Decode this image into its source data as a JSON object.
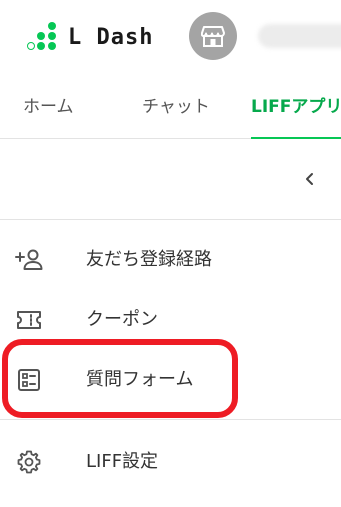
{
  "header": {
    "logo_text": "L Dash",
    "logo_icon": "ldash-dots-logo",
    "shop_avatar_icon": "store-icon",
    "brand_color": "#06c755"
  },
  "tabs": [
    {
      "label": "ホーム",
      "active": false
    },
    {
      "label": "チャット",
      "active": false
    },
    {
      "label": "LIFFアプリ",
      "active": true
    }
  ],
  "collapse_icon": "chevron-left-icon",
  "menu": {
    "items": [
      {
        "label": "友だち登録経路",
        "icon": "person-add-icon"
      },
      {
        "label": "クーポン",
        "icon": "ticket-icon"
      },
      {
        "label": "質問フォーム",
        "icon": "form-icon",
        "highlighted": true
      },
      {
        "label": "LIFF設定",
        "icon": "gear-icon"
      }
    ]
  },
  "highlight_color": "#ee1c24"
}
